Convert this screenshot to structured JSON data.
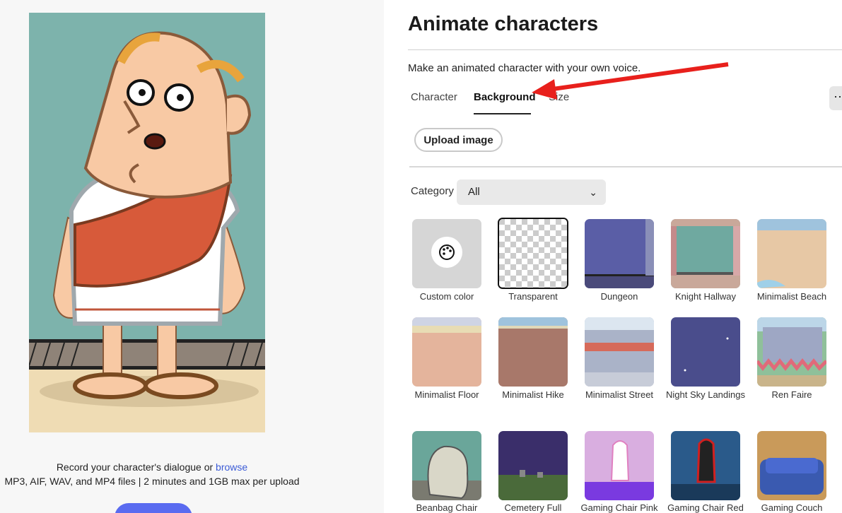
{
  "left": {
    "record_text": "Record your character's dialogue or",
    "browse_link": "browse",
    "formats_text": "MP3, AIF, WAV, and MP4 files | 2 minutes and 1GB max per upload"
  },
  "header": {
    "title": "Animate characters",
    "description": "Make an animated character with your own voice."
  },
  "tabs": [
    {
      "label": "Character",
      "active": false
    },
    {
      "label": "Background",
      "active": true
    },
    {
      "label": "Size",
      "active": false
    }
  ],
  "more_icon": "ellipsis-icon",
  "upload_label": "Upload image",
  "category": {
    "label": "Category",
    "selected": "All"
  },
  "backgrounds": [
    {
      "label": "Custom color"
    },
    {
      "label": "Transparent"
    },
    {
      "label": "Dungeon"
    },
    {
      "label": "Knight Hallway"
    },
    {
      "label": "Minimalist Beach"
    },
    {
      "label": "Minimalist Floor"
    },
    {
      "label": "Minimalist Hike"
    },
    {
      "label": "Minimalist Street"
    },
    {
      "label": "Night Sky Landings"
    },
    {
      "label": "Ren Faire"
    },
    {
      "label": "Beanbag Chair"
    },
    {
      "label": "Cemetery Full"
    },
    {
      "label": "Gaming Chair Pink"
    },
    {
      "label": "Gaming Chair Red"
    },
    {
      "label": "Gaming Couch"
    }
  ],
  "colors": {
    "accent": "#5a6bf0",
    "link": "#3b5bd6",
    "arrow": "#e8201c"
  }
}
